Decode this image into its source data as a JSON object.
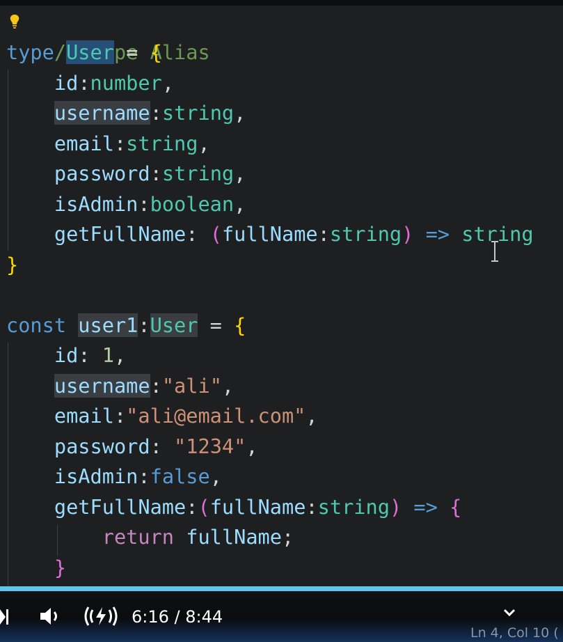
{
  "code": {
    "comment": "// Type Alias",
    "kw_type": "type",
    "type_name": "User",
    "eq": " = ",
    "open_brace": "{",
    "close_brace": "}",
    "colon": ":",
    "comma": ",",
    "semicolon": ";",
    "props": {
      "id": "id",
      "username": "username",
      "email": "email",
      "password": "password",
      "isAdmin": "isAdmin",
      "getFullName": "getFullName",
      "fullName": "fullName"
    },
    "types": {
      "number": "number",
      "string": "string",
      "boolean": "boolean"
    },
    "arrow": "=>",
    "open_paren": "(",
    "close_paren": ")",
    "kw_const": "const",
    "var_name": "user1",
    "values": {
      "id": "1",
      "username": "\"ali\"",
      "email": "\"ali@email.com\"",
      "password": "\"1234\"",
      "isAdmin": "false"
    },
    "kw_return": "return"
  },
  "player": {
    "time_display": "6:16 / 8:44",
    "progress_fraction": 0.719
  },
  "status_bar": {
    "position": "Ln 4, Col 10 ("
  },
  "colors": {
    "keyword": "#569cd6",
    "type": "#4ec9b0",
    "property": "#9cdcfe",
    "string": "#ce9178",
    "number": "#b5cea8",
    "comment": "#6a9955",
    "brace": "#ffd700",
    "paren": "#da70d6",
    "progress": "#5fc5ea"
  },
  "icons": [
    "lightbulb-icon",
    "text-cursor-icon",
    "skip-next-icon",
    "volume-icon",
    "stable-volume-icon",
    "chevron-down-icon"
  ]
}
